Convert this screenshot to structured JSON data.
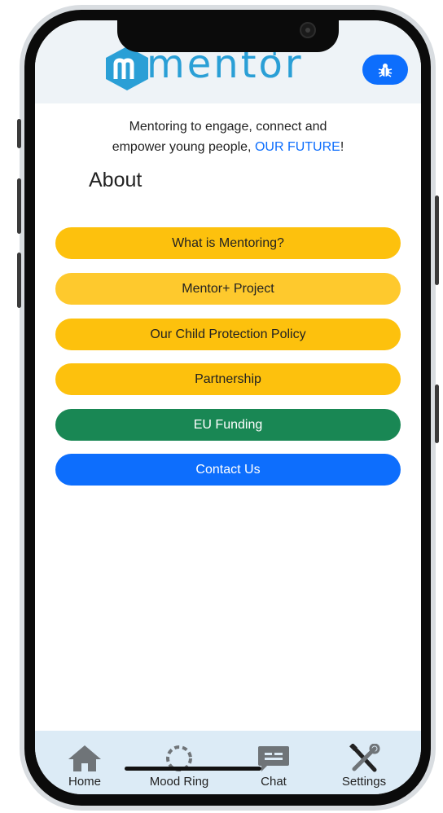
{
  "header": {
    "logo_text": "mentor",
    "logo_plus": "+",
    "bug_button_icon": "bug-icon"
  },
  "tagline": {
    "line1": "Mentoring to engage, connect and",
    "line2_prefix": "empower young people, ",
    "line2_highlight": "OUR FUTURE",
    "line2_suffix": "!"
  },
  "page": {
    "title": "About"
  },
  "menu": {
    "items": [
      {
        "label": "What is Mentoring?",
        "color": "#fdc10d"
      },
      {
        "label": "Mentor+ Project",
        "color": "#fec92d"
      },
      {
        "label": "Our Child Protection Policy",
        "color": "#fdc10d"
      },
      {
        "label": "Partnership",
        "color": "#fdc10d"
      },
      {
        "label": "EU Funding",
        "color": "#198754"
      },
      {
        "label": "Contact Us",
        "color": "#0d6efd"
      }
    ]
  },
  "tabs": [
    {
      "label": "Home",
      "icon": "home-icon"
    },
    {
      "label": "Mood Ring",
      "icon": "mood-ring-icon"
    },
    {
      "label": "Chat",
      "icon": "chat-icon"
    },
    {
      "label": "Settings",
      "icon": "settings-icon"
    }
  ],
  "colors": {
    "brand": "#2a9fd6",
    "primary": "#0d6efd",
    "accent_yellow": "#fdc10d",
    "success_green": "#198754",
    "tabbar_bg": "#dcebf6"
  }
}
